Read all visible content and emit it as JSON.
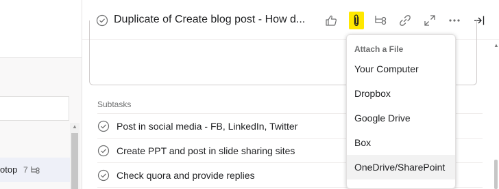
{
  "left_pane": {
    "row_label": "otop",
    "row_subtask_count": "7"
  },
  "header": {
    "title": "Duplicate of Create blog post - How d...",
    "icons": [
      "check-circle-icon",
      "thumbs-up-icon",
      "paperclip-icon",
      "subtask-icon",
      "link-icon",
      "expand-icon",
      "more-icon",
      "close-pane-icon"
    ]
  },
  "subtasks": {
    "label": "Subtasks",
    "items": [
      {
        "title": "Post in social media - FB, LinkedIn, Twitter"
      },
      {
        "title": "Create PPT and post in slide sharing sites"
      },
      {
        "title": "Check quora and provide replies"
      }
    ]
  },
  "attach_menu": {
    "heading": "Attach a File",
    "items": [
      "Your Computer",
      "Dropbox",
      "Google Drive",
      "Box",
      "OneDrive/SharePoint"
    ],
    "hovered_index": 4
  },
  "colors": {
    "highlight": "#ffe800",
    "menu_hover": "#f2f2f2",
    "icon_gray": "#6d6e6f"
  }
}
